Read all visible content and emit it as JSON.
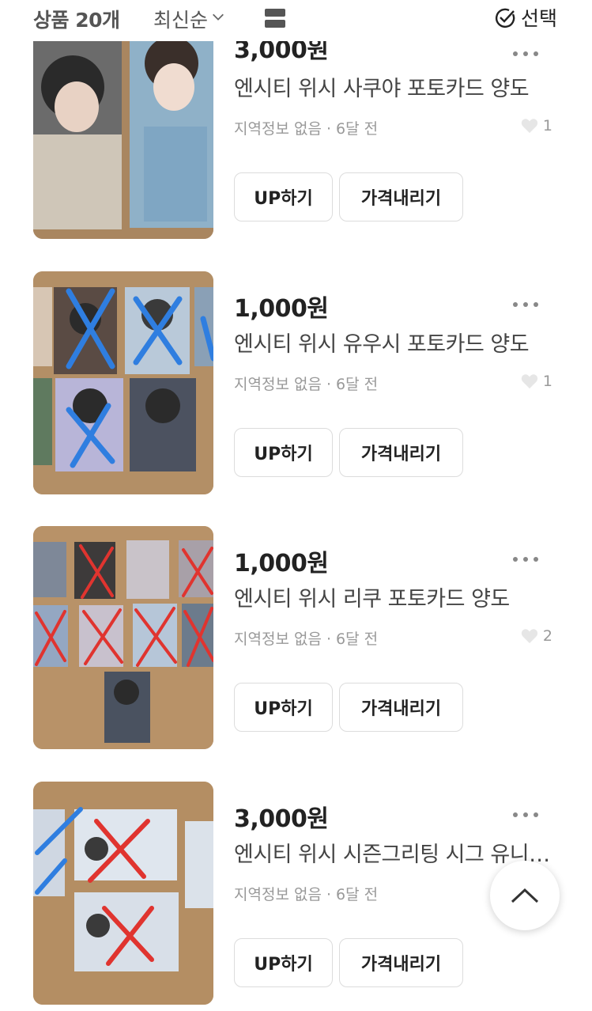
{
  "header": {
    "count_label": "상품 20개",
    "sort_label": "최신순",
    "select_label": "선택"
  },
  "items": [
    {
      "price": "3,000원",
      "title": "엔시티 위시 사쿠야 포토카드 양도",
      "meta": "지역정보 없음 · 6달 전",
      "likes": "1",
      "up_label": "UP하기",
      "price_down_label": "가격내리기",
      "mark_color": ""
    },
    {
      "price": "1,000원",
      "title": "엔시티 위시 유우시 포토카드 양도",
      "meta": "지역정보 없음 · 6달 전",
      "likes": "1",
      "up_label": "UP하기",
      "price_down_label": "가격내리기",
      "mark_color": "#2f7ee0"
    },
    {
      "price": "1,000원",
      "title": "엔시티 위시 리쿠 포토카드 양도",
      "meta": "지역정보 없음 · 6달 전",
      "likes": "2",
      "up_label": "UP하기",
      "price_down_label": "가격내리기",
      "mark_color": "#e0342f"
    },
    {
      "price": "3,000원",
      "title": "엔시티 위시 시즌그리팅 시그 유니버스 패스 양도",
      "meta": "지역정보 없음 · 6달 전",
      "likes": "",
      "up_label": "UP하기",
      "price_down_label": "가격내리기",
      "mark_color": "#e0342f"
    }
  ],
  "colors": {
    "accent_blue": "#2f7ee0",
    "accent_red": "#e0342f",
    "wood": "#b9946a"
  },
  "icons": [
    "chevron-down-icon",
    "list-view-icon",
    "check-circle-icon",
    "more-dots-icon",
    "heart-icon",
    "chevron-up-icon"
  ]
}
